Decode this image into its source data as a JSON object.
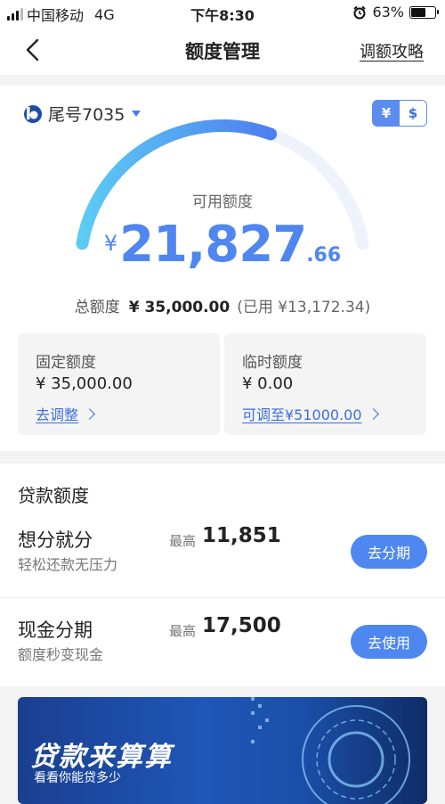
{
  "status_bar": {
    "carrier": "中国移动",
    "network": "4G",
    "time": "下午8:30",
    "battery": "63%"
  },
  "nav": {
    "title": "额度管理",
    "right_link": "调额攻略"
  },
  "account": {
    "label": "尾号7035"
  },
  "currency_toggle": {
    "cny": "¥",
    "usd": "$"
  },
  "credit": {
    "available_label": "可用额度",
    "currency_symbol": "¥",
    "available_integer": "21,827",
    "available_decimal": ".66",
    "total_label": "总额度",
    "total_value": "¥ 35,000.00",
    "used_text": "(已用 ¥13,172.34)",
    "available_fraction": 0.6236
  },
  "fixed": {
    "title": "固定额度",
    "value": "¥ 35,000.00",
    "action": "去调整"
  },
  "temp": {
    "title": "临时额度",
    "value": "¥ 0.00",
    "action": "可调至¥51000.00"
  },
  "loans": {
    "title": "贷款额度",
    "items": [
      {
        "name": "想分就分",
        "sub": "轻松还款无压力",
        "max_label": "最高",
        "max_value": "11,851",
        "button": "去分期"
      },
      {
        "name": "现金分期",
        "sub": "额度秒变现金",
        "max_label": "最高",
        "max_value": "17,500",
        "button": "去使用"
      }
    ]
  },
  "banner": {
    "title": "贷款来算算",
    "subtitle": "看看你能贷多少"
  },
  "colors": {
    "accent": "#4f86f0",
    "button": "#4e87ef",
    "gauge_start": "#5ccbf5",
    "gauge_end": "#4d7fef",
    "gauge_track": "#eef2fb"
  }
}
